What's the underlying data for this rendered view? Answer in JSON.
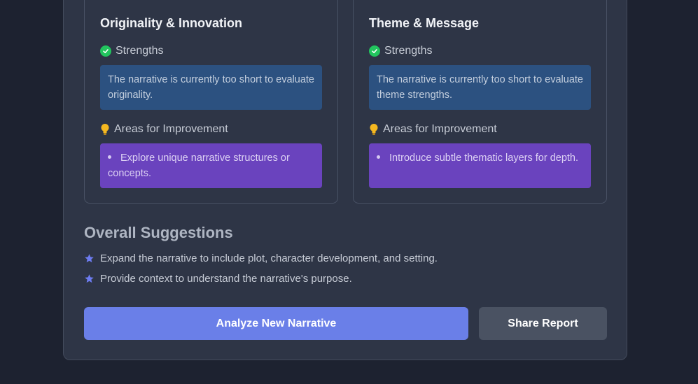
{
  "cards": [
    {
      "title": "Originality & Innovation",
      "strengths_label": "Strengths",
      "strengths_text": "The narrative is currently too short to evaluate originality.",
      "improvement_label": "Areas for Improvement",
      "improvement_items": [
        "Explore unique narrative structures or concepts."
      ]
    },
    {
      "title": "Theme & Message",
      "strengths_label": "Strengths",
      "strengths_text": "The narrative is currently too short to evaluate theme strengths.",
      "improvement_label": "Areas for Improvement",
      "improvement_items": [
        "Introduce subtle thematic layers for depth."
      ]
    }
  ],
  "overall": {
    "title": "Overall Suggestions",
    "items": [
      "Expand the narrative to include plot, character development, and setting.",
      "Provide context to understand the narrative's purpose."
    ]
  },
  "actions": {
    "analyze_label": "Analyze New Narrative",
    "share_label": "Share Report"
  },
  "icons": {
    "strengths": "check-circle-icon",
    "improvement": "lightbulb-icon",
    "suggestion": "star-icon"
  },
  "colors": {
    "background": "#1d2230",
    "panel": "#2e3546",
    "strength_box": "#2c5180",
    "improvement_box": "#6a43be",
    "success": "#22c55e",
    "bulb": "#f5b820",
    "star": "#6d7cf0",
    "primary_button": "#6a7fe8",
    "secondary_button": "#4a5262"
  }
}
